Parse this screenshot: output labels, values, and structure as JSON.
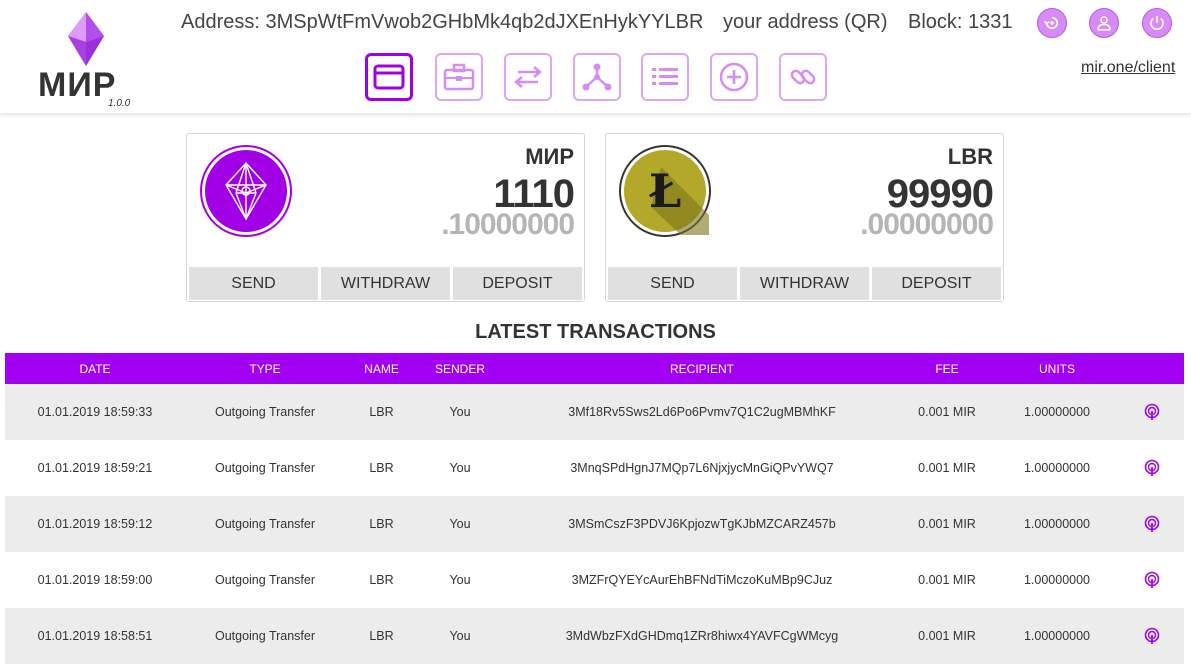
{
  "header": {
    "logo_text": "МИР",
    "version": "1.0.0",
    "address": "Address: 3MSpWtFmVwob2GHbMk4qb2dJXEnHykYYLBR",
    "qr_link": "your address (QR)",
    "block": "Block: 1331",
    "client_link": "mir.one/client",
    "top_icons": [
      "refresh-icon",
      "user-icon",
      "power-icon"
    ],
    "nav_icons": [
      "wallet-icon",
      "briefcase-icon",
      "exchange-icon",
      "network-icon",
      "list-icon",
      "plus-circle-icon",
      "link-icon"
    ]
  },
  "wallets": [
    {
      "name": "МИР",
      "integer": "1110",
      "fraction": ".10000000",
      "send": "SEND",
      "withdraw": "WITHDRAW",
      "deposit": "DEPOSIT"
    },
    {
      "name": "LBR",
      "integer": "99990",
      "fraction": ".00000000",
      "send": "SEND",
      "withdraw": "WITHDRAW",
      "deposit": "DEPOSIT"
    }
  ],
  "transactions_title": "LATEST TRANSACTIONS",
  "table": {
    "columns": [
      "DATE",
      "TYPE",
      "NAME",
      "SENDER",
      "RECIPIENT",
      "FEE",
      "UNITS"
    ],
    "rows": [
      [
        "01.01.2019 18:59:33",
        "Outgoing Transfer",
        "LBR",
        "You",
        "3Mf18Rv5Sws2Ld6Po6Pvmv7Q1C2ugMBMhKF",
        "0.001 MIR",
        "1.00000000"
      ],
      [
        "01.01.2019 18:59:21",
        "Outgoing Transfer",
        "LBR",
        "You",
        "3MnqSPdHgnJ7MQp7L6NjxjycMnGiQPvYWQ7",
        "0.001 MIR",
        "1.00000000"
      ],
      [
        "01.01.2019 18:59:12",
        "Outgoing Transfer",
        "LBR",
        "You",
        "3MSmCszF3PDVJ6KpjozwTgKJbMZCARZ457b",
        "0.001 MIR",
        "1.00000000"
      ],
      [
        "01.01.2019 18:59:00",
        "Outgoing Transfer",
        "LBR",
        "You",
        "3MZFrQYEYcAurEhBFNdTiMczoKuMBp9CJuz",
        "0.001 MIR",
        "1.00000000"
      ],
      [
        "01.01.2019 18:58:51",
        "Outgoing Transfer",
        "LBR",
        "You",
        "3MdWbzFXdGHDmq1ZRr8hiwx4YAVFCgWMcyg",
        "0.001 MIR",
        "1.00000000"
      ]
    ]
  },
  "colors": {
    "accent": "#a100f2",
    "accent_light": "#d78cf5",
    "row_alt": "#ececec",
    "button_gray": "#e0e0e0",
    "lbr_gold": "#b3a82a"
  }
}
